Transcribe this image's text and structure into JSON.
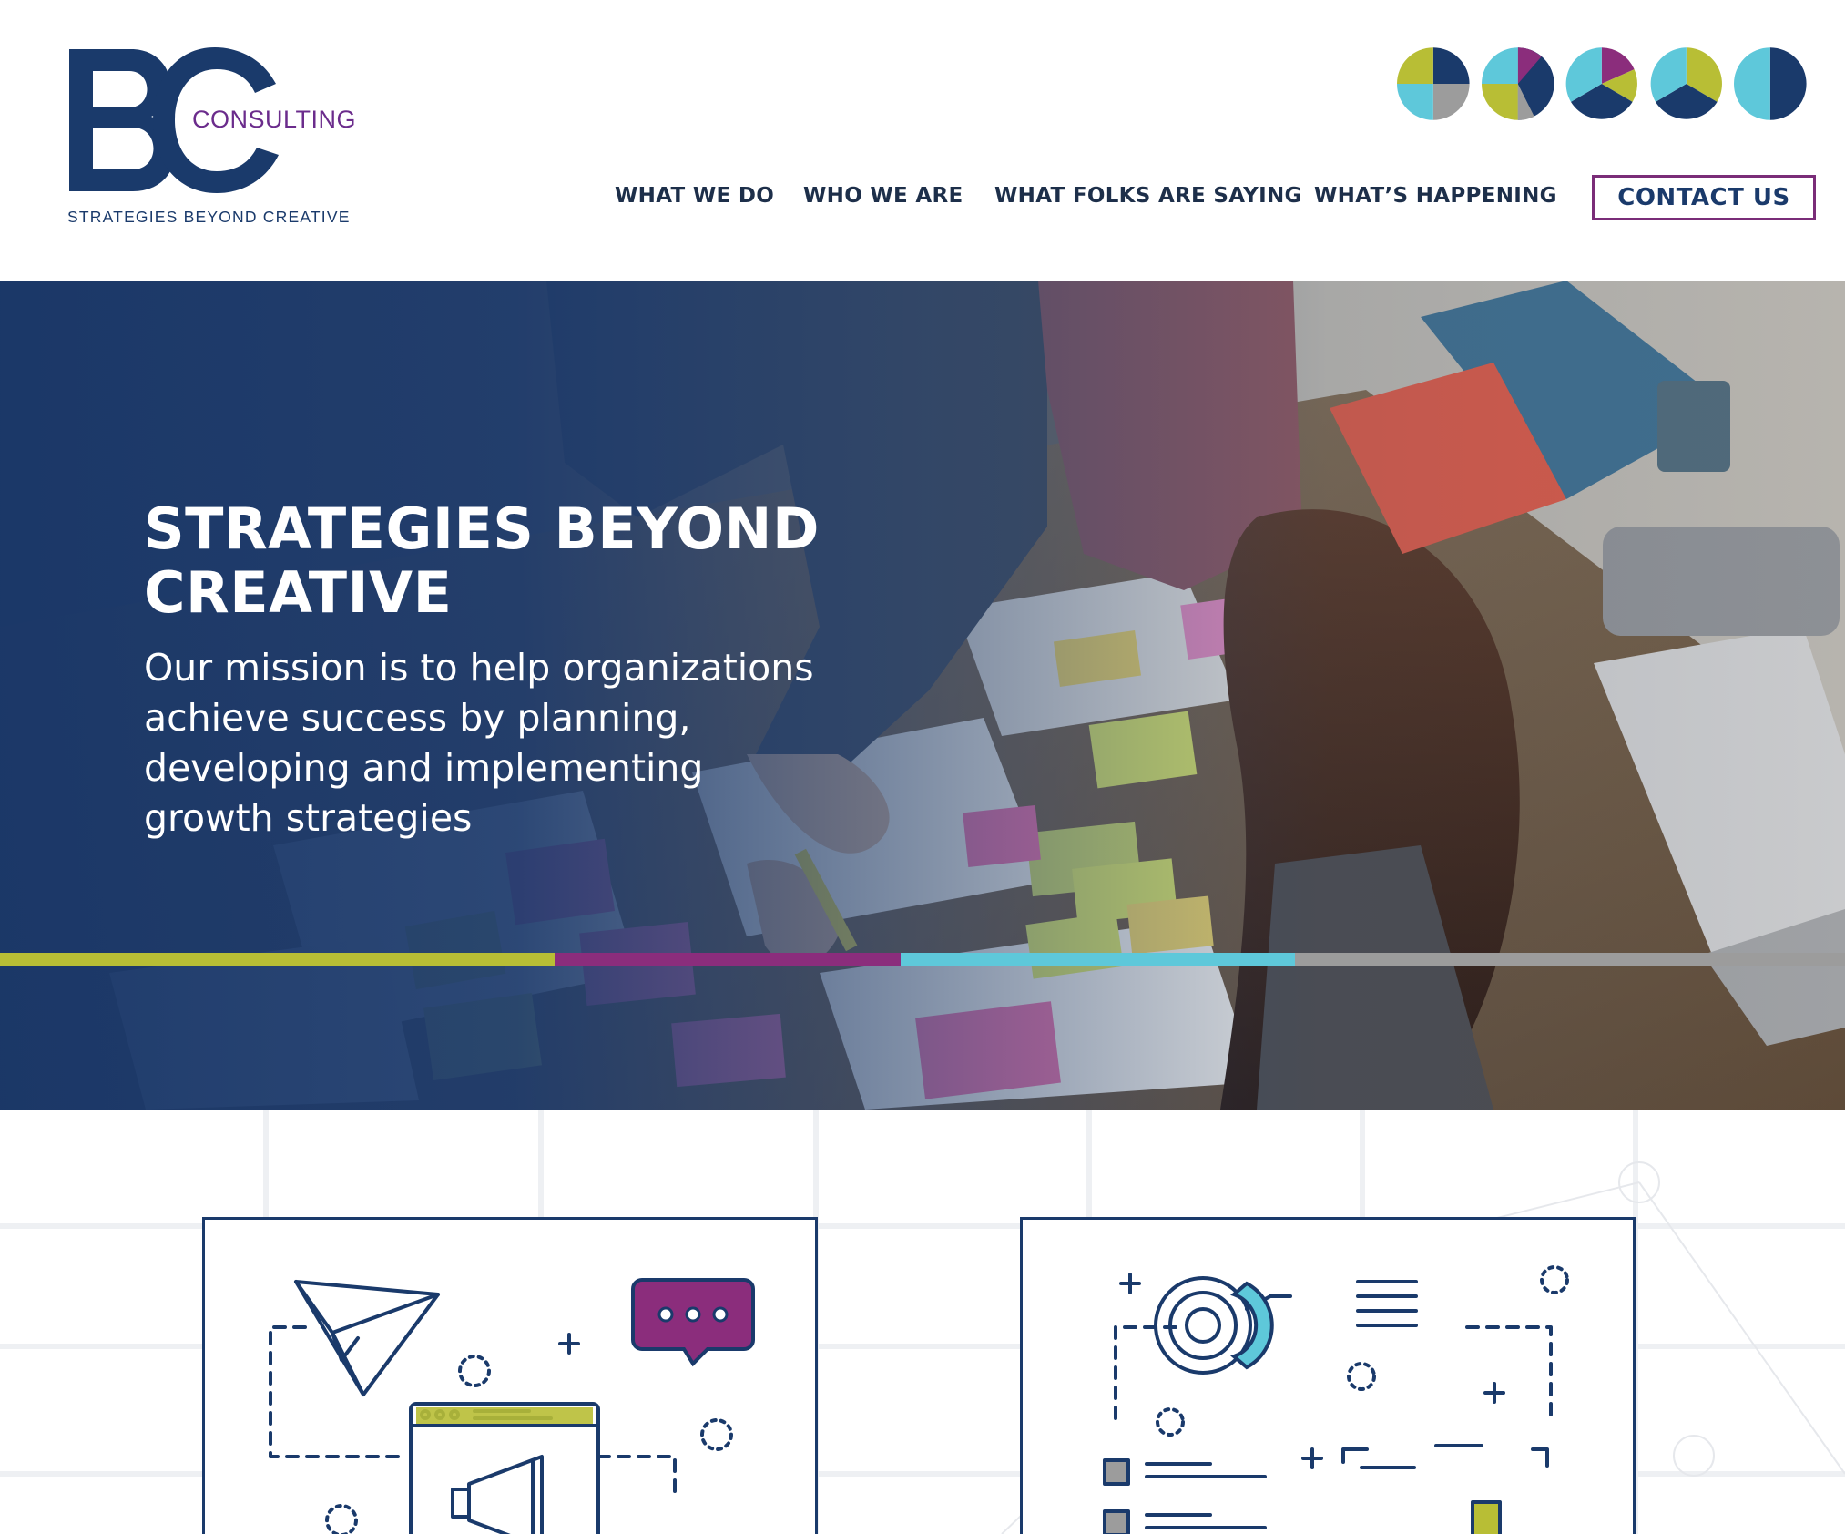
{
  "brand": {
    "logo_letters": "BC",
    "logo_word": "CONSULTING",
    "tagline": "STRATEGIES BEYOND CREATIVE",
    "colors": {
      "navy": "#1a3a6b",
      "purple": "#7a2d78",
      "lime": "#b8be35",
      "cyan": "#5ec8da",
      "gray": "#9c9c9c"
    }
  },
  "header": {
    "dot_icons": [
      "quarter-pie-icon",
      "split-pie-icon",
      "tri-pie-icon",
      "tri-pie-alt-icon",
      "half-pie-icon"
    ]
  },
  "nav": {
    "items": [
      {
        "label": "WHAT WE DO"
      },
      {
        "label": "WHO WE ARE"
      },
      {
        "label": "WHAT FOLKS ARE SAYING"
      },
      {
        "label": "WHAT’S HAPPENING"
      }
    ],
    "contact_label": "CONTACT US"
  },
  "hero": {
    "title_line1": "STRATEGIES BEYOND",
    "title_line2": "CREATIVE",
    "subtitle_lines": [
      "Our mission is to help organizations",
      "achieve success by planning,",
      "developing and implementing",
      "growth strategies"
    ],
    "stripe_colors": [
      "#b8be35",
      "#8b2d7c",
      "#5ec8da",
      "#9c9c9c"
    ]
  },
  "cards": [
    {
      "icon": "marketing-megaphone-illustration"
    },
    {
      "icon": "analytics-dashboard-illustration"
    }
  ]
}
